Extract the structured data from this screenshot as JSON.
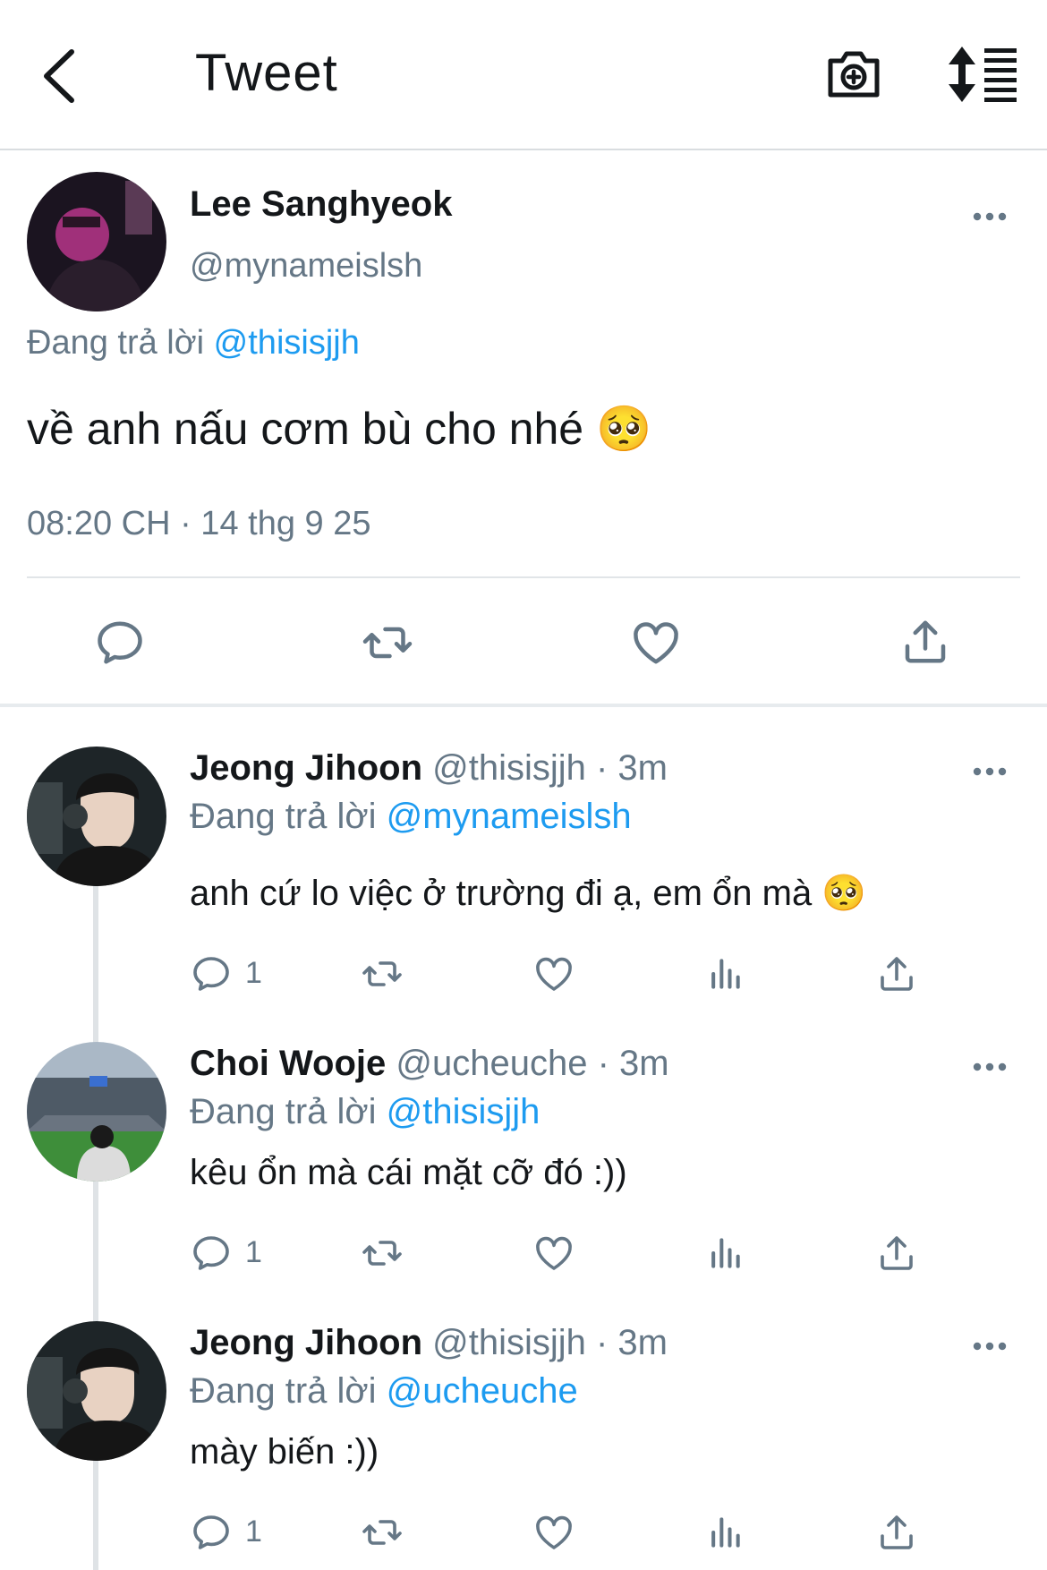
{
  "header": {
    "title": "Tweet"
  },
  "main_tweet": {
    "name": "Lee Sanghyeok",
    "handle": "@mynameislsh",
    "reply_prefix": "Đang trả lời",
    "reply_to": "@thisisjjh",
    "text": "về anh nấu cơm bù cho nhé 🥺",
    "timestamp": "08:20 CH · 14 thg 9 25"
  },
  "replies": [
    {
      "name": "Jeong Jihoon",
      "handle_time": "@thisisjjh · 3m",
      "reply_prefix": "Đang trả lời",
      "reply_to": "@mynameislsh",
      "text": "anh cứ lo việc ở trường đi ạ, em ổn mà 🥺",
      "reply_count": "1"
    },
    {
      "name": "Choi Wooje",
      "handle_time": "@ucheuche · 3m",
      "reply_prefix": "Đang trả lời",
      "reply_to": "@thisisjjh",
      "text": "kêu ổn mà cái mặt cỡ đó :))",
      "reply_count": "1"
    },
    {
      "name": "Jeong Jihoon",
      "handle_time": "@thisisjjh · 3m",
      "reply_prefix": "Đang trả lời",
      "reply_to": "@ucheuche",
      "text": "mày biến :))",
      "reply_count": "1"
    }
  ],
  "icons": [
    "back-arrow-icon",
    "camera-plus-icon",
    "sort-icon",
    "more-icon",
    "reply-icon",
    "retweet-icon",
    "like-icon",
    "share-icon",
    "analytics-icon"
  ],
  "colors": {
    "accent": "#1d9bf0",
    "secondary_text": "#657786",
    "primary_text": "#14171a"
  }
}
